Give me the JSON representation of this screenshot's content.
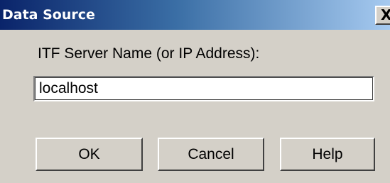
{
  "window": {
    "title": "Data Source",
    "close_glyph": "X",
    "close_icon": "close-icon"
  },
  "form": {
    "server_label": "ITF Server Name (or IP Address):",
    "server_value": "localhost"
  },
  "buttons": {
    "ok_label": "OK",
    "cancel_label": "Cancel",
    "help_label": "Help"
  },
  "colors": {
    "titlebar_start": "#0a246a",
    "titlebar_end": "#a6caf0",
    "dialog_face": "#d4d0c8"
  }
}
